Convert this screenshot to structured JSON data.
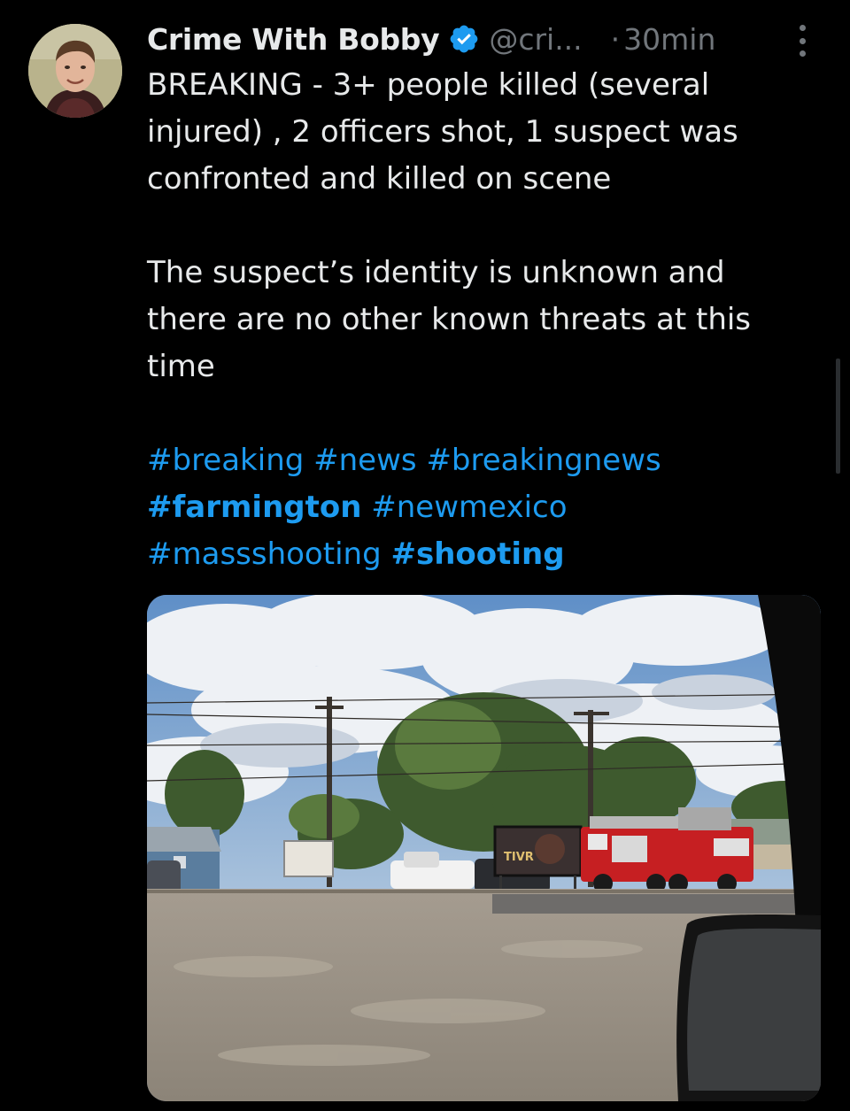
{
  "tweet": {
    "author": {
      "display_name": "Crime With Bobby",
      "handle": "@cri...",
      "verified": true
    },
    "separator": "·",
    "timestamp": "30min",
    "lines": [
      "BREAKING - 3+ people killed (several",
      "injured) , 2 officers shot, 1 suspect was",
      "confronted and killed on scene"
    ],
    "lines2": [
      "The suspect’s identity is unknown and",
      "there are no other known threats at this",
      "time"
    ],
    "hashtags": {
      "breaking": "#breaking",
      "news": "#news",
      "breakingnews": "#breakingnews",
      "farmington": "#farmington",
      "newmexico": "#newmexico",
      "massshooting": "#massshooting",
      "shooting": "#shooting"
    },
    "media": {
      "description_icon": "photo"
    }
  },
  "colors": {
    "background": "#000000",
    "text": "#e7e9ea",
    "secondary": "#71767b",
    "accent": "#1d9bf0"
  },
  "icons": {
    "verified": "verified-badge-icon",
    "more": "more-options-icon"
  }
}
